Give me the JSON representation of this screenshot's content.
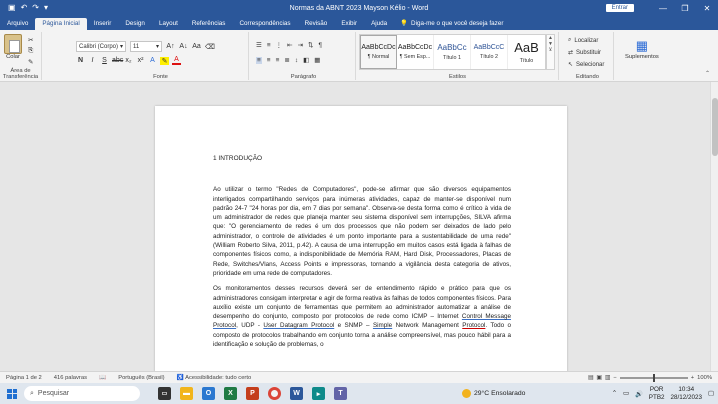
{
  "window": {
    "title": "Normas da ABNT 2023 Mayson Kélio - Word",
    "signin_label": "Entrar",
    "controls": [
      "—",
      "❐",
      "✕"
    ]
  },
  "qat": {
    "icons": [
      "save-icon",
      "undo-icon",
      "redo-icon",
      "customize-icon"
    ]
  },
  "tabs": [
    {
      "label": "Arquivo",
      "active": false
    },
    {
      "label": "Página Inicial",
      "active": true
    },
    {
      "label": "Inserir",
      "active": false
    },
    {
      "label": "Design",
      "active": false
    },
    {
      "label": "Layout",
      "active": false
    },
    {
      "label": "Referências",
      "active": false
    },
    {
      "label": "Correspondências",
      "active": false
    },
    {
      "label": "Revisão",
      "active": false
    },
    {
      "label": "Exibir",
      "active": false
    },
    {
      "label": "Ajuda",
      "active": false
    }
  ],
  "tell_me": "Diga-me o que você deseja fazer",
  "ribbon": {
    "clipboard": {
      "paste_label": "Colar",
      "group_label": "Área de Transferência"
    },
    "font": {
      "font_name": "Calibri (Corpo)",
      "font_size": "11",
      "group_label": "Fonte"
    },
    "paragraph": {
      "group_label": "Parágrafo"
    },
    "styles": {
      "group_label": "Estilos",
      "items": [
        {
          "sample": "AaBbCcDc",
          "name": "¶ Normal"
        },
        {
          "sample": "AaBbCcDc",
          "name": "¶ Sem Esp..."
        },
        {
          "sample": "AaBbCc",
          "name": "Título 1"
        },
        {
          "sample": "AaBbCcC",
          "name": "Título 2"
        },
        {
          "sample": "AaB",
          "name": "Título"
        }
      ]
    },
    "editing": {
      "find": "Localizar",
      "replace": "Substituir",
      "select": "Selecionar",
      "group_label": "Editando"
    },
    "supplements": {
      "label": "Suplementos",
      "group_label": "Suplementos"
    }
  },
  "document": {
    "heading": "1 INTRODUÇÃO",
    "para1": "Ao utilizar o termo \"Redes de Computadores\", pode-se afirmar que são diversos equipamentos interligados compartilhando serviços para inúmeras atividades, capaz de manter-se disponível num padrão 24-7 \"24 horas por dia, em 7 dias por semana\". Observa-se desta forma como é crítico à vida de um administrador de redes que planeja manter seu sistema disponível sem interrupções, SILVA afirma que: \"O gerenciamento de redes é um dos processos que não podem ser deixados de lado pelo administrador, o controle de atividades é um ponto importante para a sustentabilidade de uma rede\" (William Roberto Silva, 2011, p.42). A causa de uma interrupção em muitos casos está ligada à falhas de componentes físicos como, a indisponibilidade de Memória RAM, Hard Disk, Processadores, Placas de Rede, Switches/Vlans, Access Points e impressoras, tornando a vigilância desta categoria de ativos, prioridade em uma rede de computadores.",
    "para2_a": "Os monitoramentos desses recursos deverá ser de entendimento rápido e prático para que os administradores consigam interpretar e agir de forma reativa às falhas de todos componentes físicos. Para auxílio existe um conjunto de ferramentas que permitem ao administrador automatizar a análise de desempenho do conjunto, composto por protocolos de rede como ICMP – Internet ",
    "para2_link1": "Control Message Protocol",
    "para2_b": ", UDP - ",
    "para2_link2": "User Datagram Protocol",
    "para2_c": " e SNMP – ",
    "para2_link3": "Simple",
    "para2_d": " Network Management ",
    "para2_link4": "Protocol",
    "para2_e": ". Todo o composto de protocolos trabalhando em conjunto torna a análise compreensível, mas pouco hábil para a identificação e solução de problemas, o"
  },
  "statusbar": {
    "page": "Página 1 de 2",
    "words": "416 palavras",
    "language": "Português (Brasil)",
    "accessibility": "Acessibilidade: tudo certo",
    "zoom": "100%"
  },
  "taskbar": {
    "search_placeholder": "Pesquisar",
    "weather": "29°C  Ensolarado",
    "lang_top": "POR",
    "lang_bottom": "PTB2",
    "time": "10:34",
    "date": "28/12/2023"
  }
}
